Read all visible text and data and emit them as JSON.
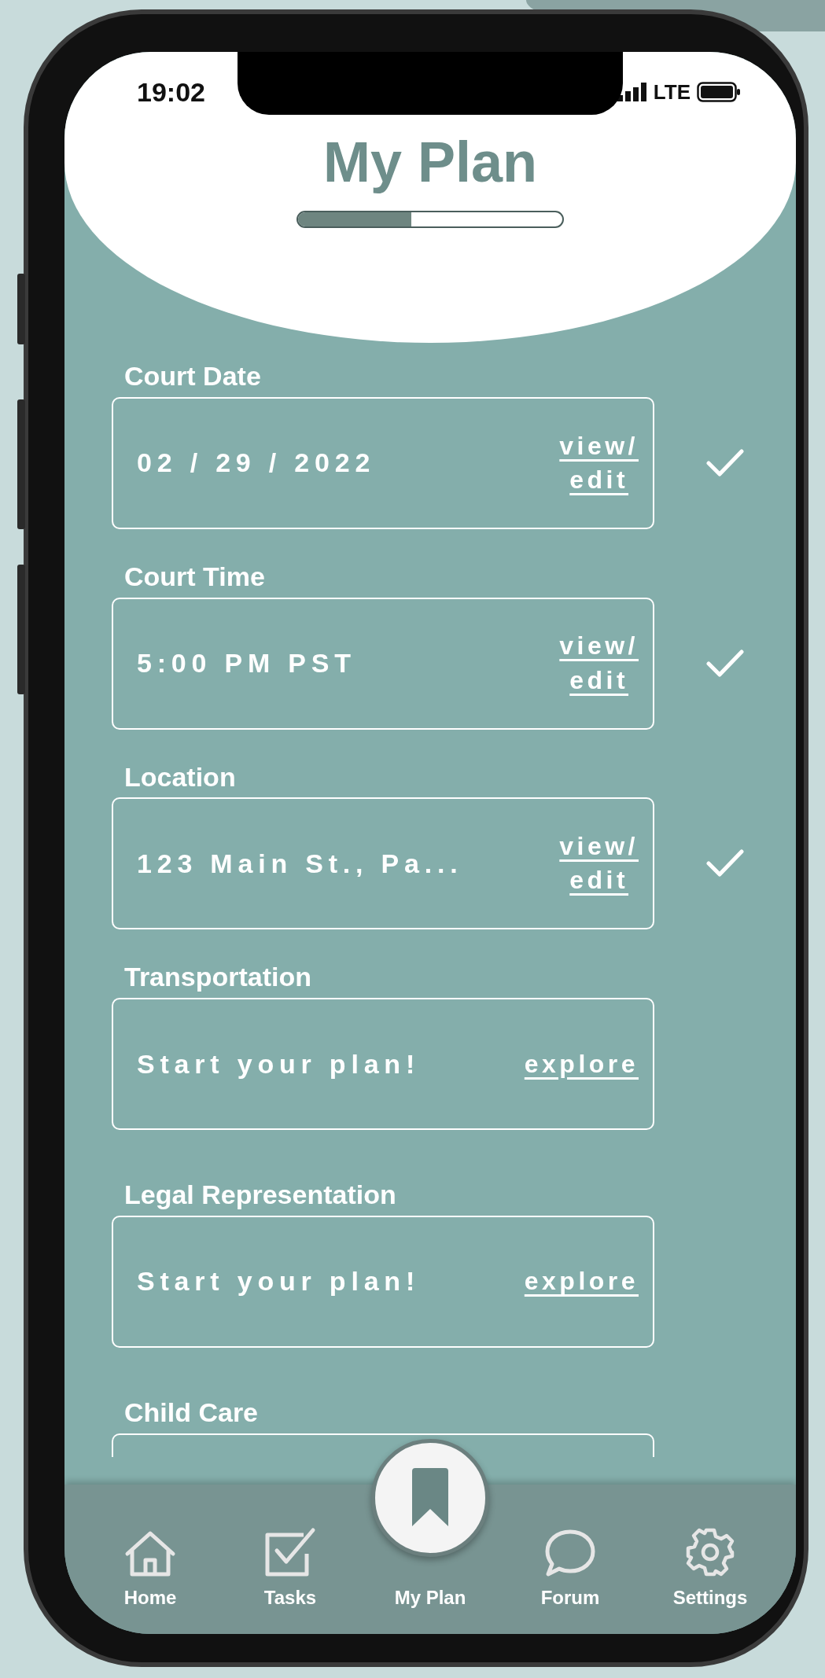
{
  "status_bar": {
    "time": "19:02",
    "network": "LTE"
  },
  "header": {
    "title": "My Plan",
    "progress": {
      "level": 0.43
    }
  },
  "sections": [
    {
      "label": "Court Date",
      "value": "02 / 29 / 2022",
      "action_lines": [
        "view/",
        "edit"
      ],
      "checked": true
    },
    {
      "label": "Court Time",
      "value": "5:00 PM PST",
      "action_lines": [
        "view/",
        "edit"
      ],
      "checked": true
    },
    {
      "label": "Location",
      "value": "123 Main St., Pa...",
      "action_lines": [
        "view/",
        "edit"
      ],
      "checked": true
    },
    {
      "label": "Transportation",
      "value": "Start your plan!",
      "action_lines": [
        "explore"
      ]
    },
    {
      "label": "Legal Representation",
      "value": "Start your plan!",
      "action_lines": [
        "explore"
      ]
    },
    {
      "label": "Child Care"
    }
  ],
  "nav": [
    {
      "kind": "home",
      "label": "Home",
      "selected": false
    },
    {
      "kind": "tasks",
      "label": "Tasks",
      "selected": false
    },
    {
      "kind": "plan",
      "label": "My Plan",
      "selected": true
    },
    {
      "kind": "forum",
      "label": "Forum",
      "selected": false
    },
    {
      "kind": "settings",
      "label": "Settings",
      "selected": false
    }
  ]
}
